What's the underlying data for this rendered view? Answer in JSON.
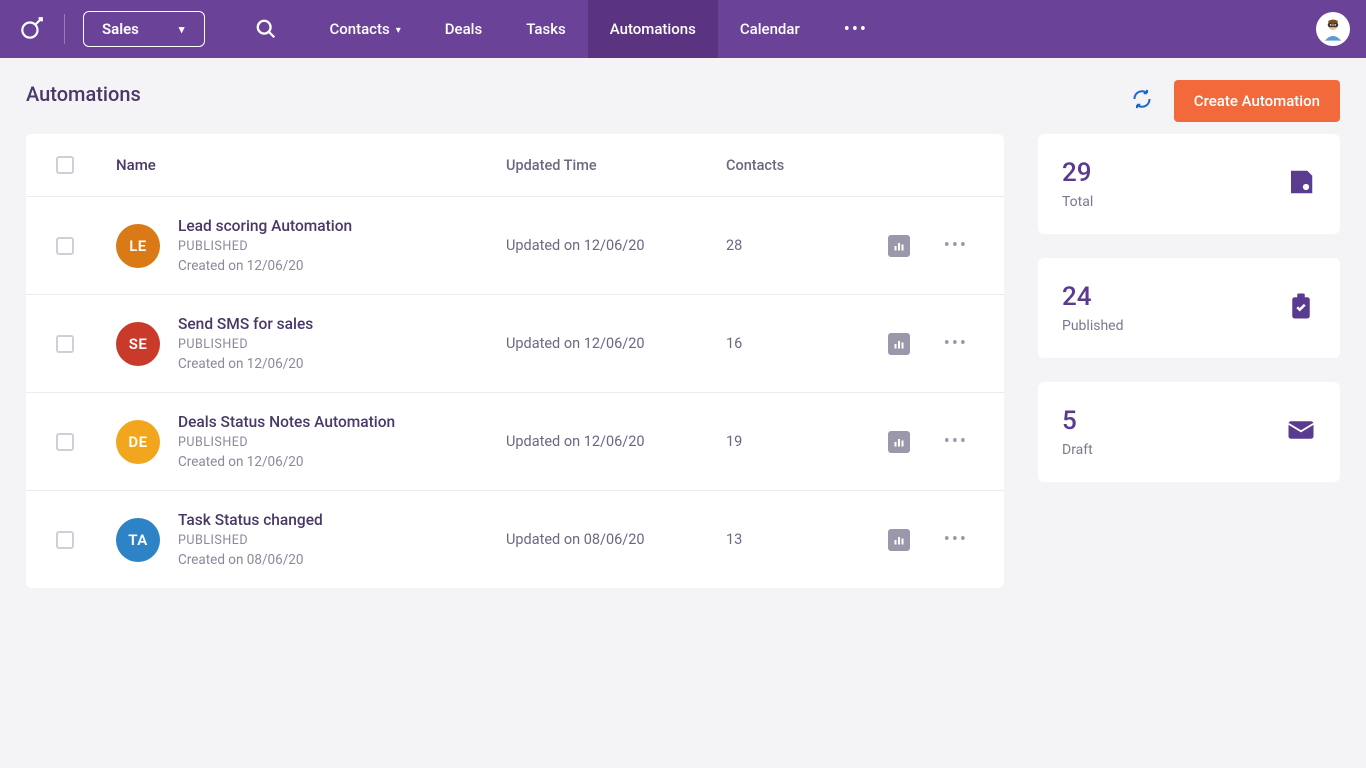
{
  "topbar": {
    "module_select": "Sales",
    "nav": [
      "Contacts",
      "Deals",
      "Tasks",
      "Automations",
      "Calendar"
    ],
    "active_index": 3
  },
  "page": {
    "title": "Automations",
    "create_button": "Create Automation"
  },
  "table": {
    "headers": {
      "name": "Name",
      "updated": "Updated Time",
      "contacts": "Contacts"
    },
    "rows": [
      {
        "initials": "LE",
        "color": "#d97a17",
        "name": "Lead scoring Automation",
        "status": "PUBLISHED",
        "created": "Created on 12/06/20",
        "updated": "Updated on 12/06/20",
        "contacts": "28"
      },
      {
        "initials": "SE",
        "color": "#c93a2b",
        "name": "Send SMS for sales",
        "status": "PUBLISHED",
        "created": "Created on 12/06/20",
        "updated": "Updated on 12/06/20",
        "contacts": "16"
      },
      {
        "initials": "DE",
        "color": "#f2a61d",
        "name": "Deals Status Notes Automation",
        "status": "PUBLISHED",
        "created": "Created on 12/06/20",
        "updated": "Updated on 12/06/20",
        "contacts": "19"
      },
      {
        "initials": "TA",
        "color": "#2d83c5",
        "name": "Task Status changed",
        "status": "PUBLISHED",
        "created": "Created on 08/06/20",
        "updated": "Updated on 08/06/20",
        "contacts": "13"
      }
    ]
  },
  "summary": [
    {
      "count": "29",
      "label": "Total",
      "icon": "save"
    },
    {
      "count": "24",
      "label": "Published",
      "icon": "clipboard-check"
    },
    {
      "count": "5",
      "label": "Draft",
      "icon": "mail"
    }
  ]
}
